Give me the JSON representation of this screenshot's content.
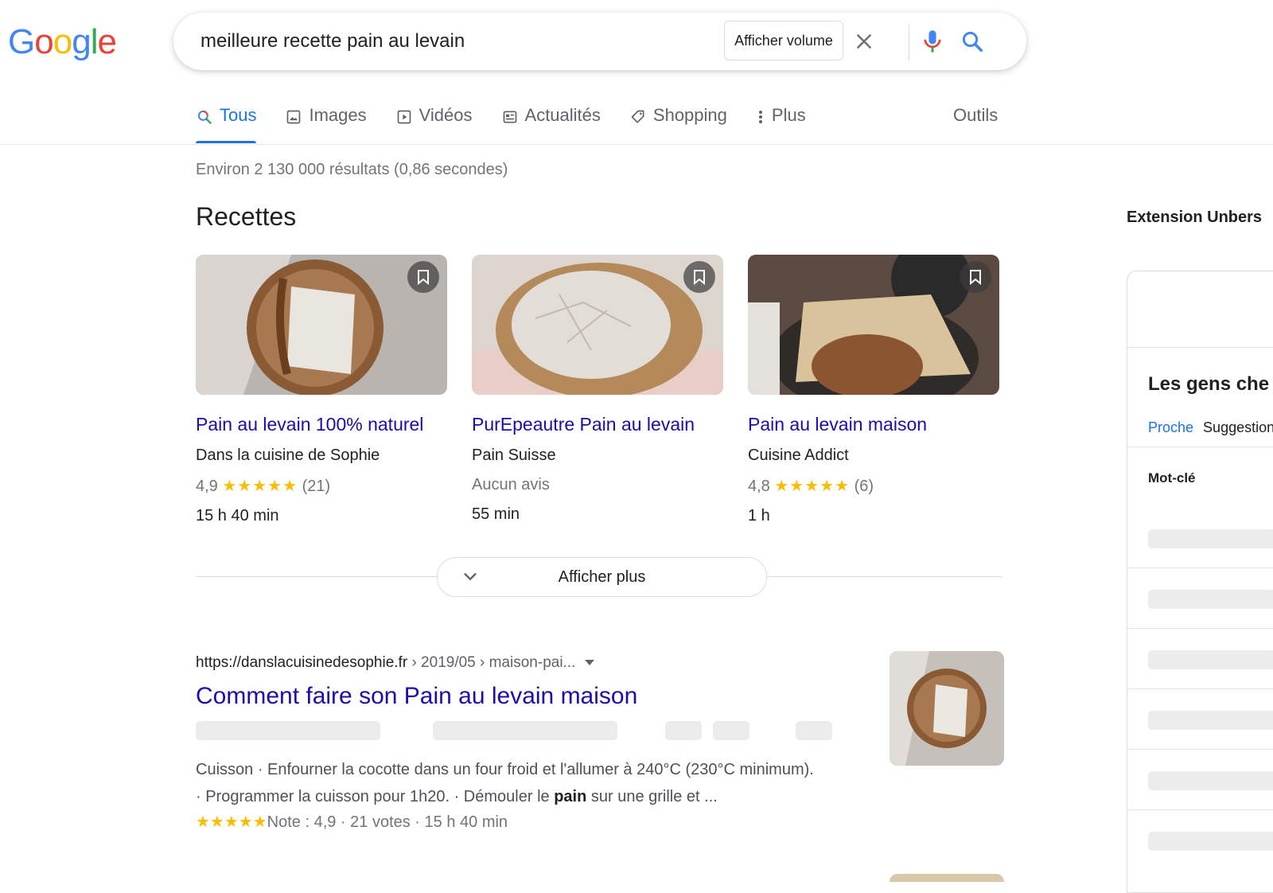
{
  "logo": {
    "letters": [
      "G",
      "o",
      "o",
      "g",
      "l",
      "e"
    ],
    "colors": [
      "#4285f4",
      "#ea4335",
      "#fbbc05",
      "#4285f4",
      "#34a853",
      "#ea4335"
    ]
  },
  "search": {
    "query": "meilleure recette pain au levain",
    "volume_button": "Afficher volume",
    "icons": [
      "close-icon",
      "mic-icon",
      "search-icon"
    ]
  },
  "tabs": [
    {
      "label": "Tous",
      "icon": "search-icon",
      "active": true
    },
    {
      "label": "Images",
      "icon": "image-icon"
    },
    {
      "label": "Vidéos",
      "icon": "video-icon"
    },
    {
      "label": "Actualités",
      "icon": "news-icon"
    },
    {
      "label": "Shopping",
      "icon": "tag-icon"
    },
    {
      "label": "Plus",
      "icon": "more-vert-icon"
    }
  ],
  "tools_label": "Outils",
  "stats": "Environ 2 130 000 résultats (0,86 secondes)",
  "recipes": {
    "heading": "Recettes",
    "cards": [
      {
        "title": "Pain au levain 100% naturel",
        "source": "Dans la cuisine de Sophie",
        "rating": "4,9",
        "stars": "★★★★★",
        "reviews": "(21)",
        "time": "15 h 40 min"
      },
      {
        "title": "PurEpeautre Pain au levain",
        "source": "Pain Suisse",
        "no_reviews": "Aucun avis",
        "time": "55 min"
      },
      {
        "title": "Pain au levain maison",
        "source": "Cuisine Addict",
        "rating": "4,8",
        "stars": "★★★★★",
        "reviews": "(6)",
        "time": "1 h"
      }
    ],
    "show_more": "Afficher plus"
  },
  "result": {
    "url_base": "https://danslacuisinedesophie.fr",
    "url_path": " › 2019/05 › maison-pai...",
    "title": "Comment faire son Pain au levain maison",
    "snippet_1": "Cuisson · Enfourner la cocotte dans un four froid et l'allumer à 240°C (230°C minimum).",
    "snippet_2a": "· Programmer la cuisson pour 1h20. · Démouler le ",
    "snippet_bold": "pain",
    "snippet_2b": " sur une grille et ...",
    "stars": "★★★★★",
    "meta": "Note : 4,9 · 21 votes · 15 h 40 min"
  },
  "sidebar": {
    "extension_title": "Extension Unbers",
    "heading": "Les gens che",
    "tab_active": "Proche",
    "tab_other": "Suggestion",
    "keyword_label": "Mot-clé"
  }
}
